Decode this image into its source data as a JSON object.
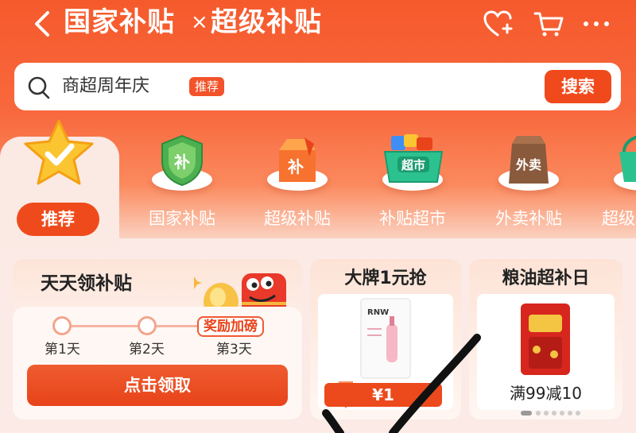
{
  "header": {
    "title_main": "国家补贴",
    "title_sep": "×",
    "title_second": "超级补贴",
    "icons": [
      "back-arrow-icon",
      "heart-plus-icon",
      "cart-icon",
      "more-icon"
    ]
  },
  "search": {
    "placeholder": "商超周年庆",
    "tag": "推荐",
    "button": "搜索"
  },
  "categories": [
    {
      "label": "推荐",
      "icon": "star-check-icon",
      "active": true
    },
    {
      "label": "国家补贴",
      "icon": "shield-bu-icon"
    },
    {
      "label": "超级补贴",
      "icon": "bag-bu-icon"
    },
    {
      "label": "补贴超市",
      "icon": "basket-chaoshi-icon"
    },
    {
      "label": "外卖补贴",
      "icon": "bag-waimai-icon"
    },
    {
      "label": "超级",
      "icon": "basket-icon"
    }
  ],
  "cards": {
    "daily": {
      "title": "天天领补贴",
      "reward_badge": "奖励加磅",
      "days": [
        "第1天",
        "第2天",
        "第3天"
      ],
      "button": "点击领取"
    },
    "brand": {
      "title": "大牌1元抢",
      "product_brand": "RNW",
      "price": "¥1"
    },
    "grain": {
      "title": "粮油超补日",
      "deal": "满99减10"
    }
  },
  "colors": {
    "accent": "#f04a1c",
    "header_top": "#f55a2c",
    "page_bg": "#fbe9e4"
  }
}
